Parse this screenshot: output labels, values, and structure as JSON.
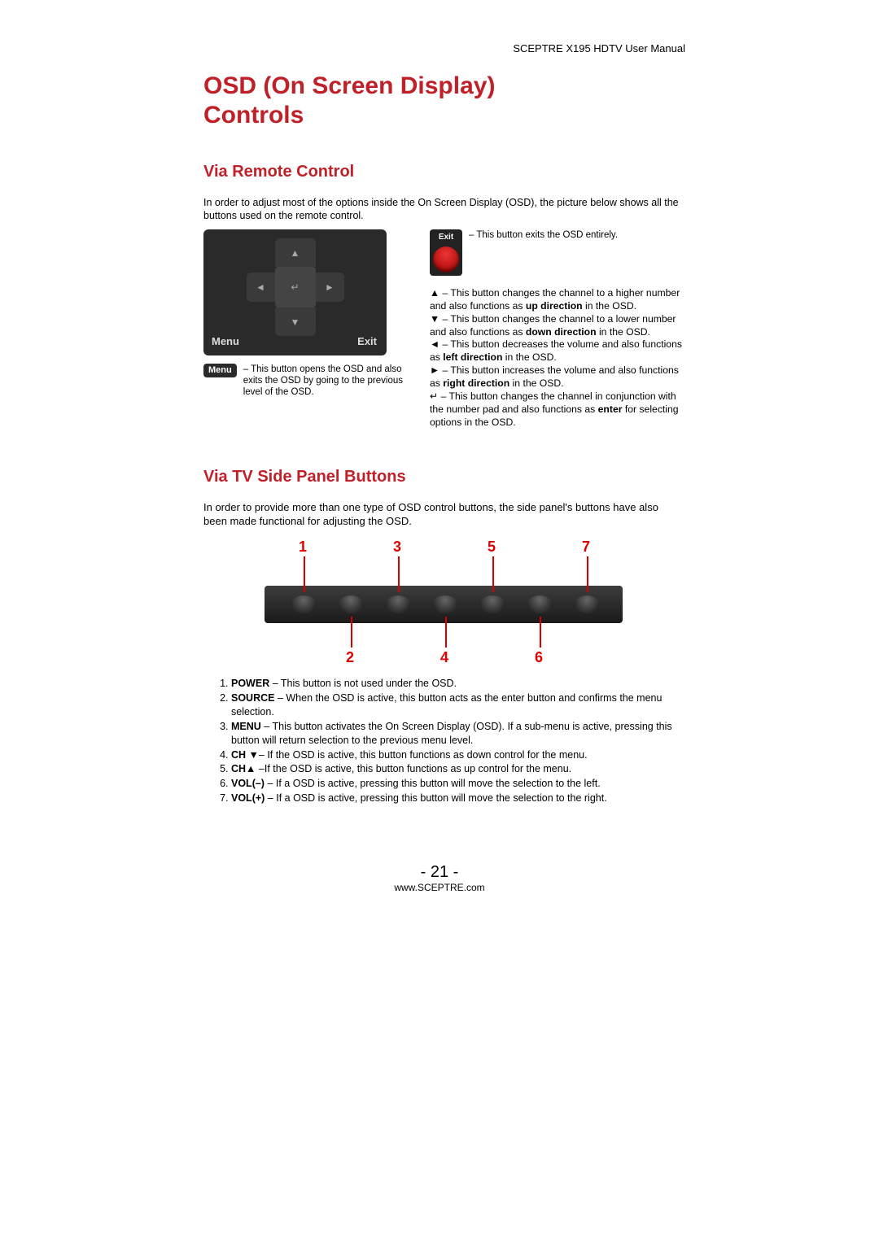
{
  "header": {
    "product": "SCEPTRE X195 HDTV User Manual"
  },
  "title_line1": "OSD (On Screen Display)",
  "title_line2": "Controls",
  "section1": {
    "heading": "Via Remote Control",
    "intro": "In order to adjust most of the options inside the On Screen Display (OSD), the picture below shows all the buttons used on the remote control.",
    "remote": {
      "menu_label": "Menu",
      "exit_label": "Exit"
    },
    "menu_btn": "Menu",
    "menu_desc": " – This button opens the OSD and also exits the OSD by going to the previous level of the OSD.",
    "exit_btn": "Exit",
    "exit_desc": " – This button exits the OSD entirely.",
    "arrow_up_pre": "▲ – This button changes the channel to a higher number and also functions as ",
    "arrow_up_bold": "up direction",
    "arrow_up_post": " in the OSD.",
    "arrow_dn_pre": "▼ – This button changes the channel to a lower number and also functions as ",
    "arrow_dn_bold": "down direction",
    "arrow_dn_post": " in the OSD.",
    "arrow_lf_pre": "◄ – This button decreases the volume and also functions as ",
    "arrow_lf_bold": "left direction",
    "arrow_lf_post": " in the OSD.",
    "arrow_rt_pre": "► – This button increases the volume and also functions as ",
    "arrow_rt_bold": "right direction",
    "arrow_rt_post": " in the OSD.",
    "enter_pre": "↵ – This button changes the channel in conjunction with the number pad and also functions as ",
    "enter_bold": "enter",
    "enter_post": " for selecting options in the OSD."
  },
  "section2": {
    "heading": "Via TV Side Panel Buttons",
    "intro": "In order to provide more than one type of OSD control buttons, the side panel's buttons have also been made functional for adjusting the OSD.",
    "labels": {
      "n1": "1",
      "n2": "2",
      "n3": "3",
      "n4": "4",
      "n5": "5",
      "n6": "6",
      "n7": "7"
    },
    "items": {
      "i1b": "POWER",
      "i1": " – This button is not used under the OSD.",
      "i2b": "SOURCE",
      "i2": " – When the OSD is active, this button acts as the enter button and confirms the menu selection.",
      "i3b": "MENU",
      "i3": " – This button activates the On Screen Display (OSD).  If a sub-menu is active, pressing this button will return selection to the previous menu level.",
      "i4b": "CH ▼",
      "i4": "– If the OSD is active, this button functions as down control for the menu.",
      "i5b": "CH▲",
      "i5": " –If the OSD is active, this button functions as up control for the menu.",
      "i6b": "VOL(–)",
      "i6": " – If a OSD is active, pressing this button will move the selection to the left.",
      "i7b": "VOL(+)",
      "i7": " – If a OSD is active, pressing this button will move the selection to the right."
    }
  },
  "footer": {
    "page": "- 21 -",
    "url": "www.SCEPTRE.com"
  }
}
